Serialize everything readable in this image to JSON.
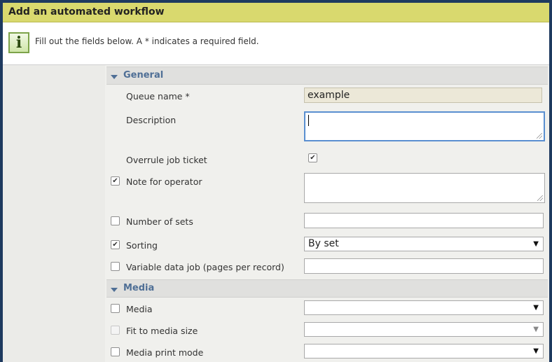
{
  "dialog": {
    "title": "Add an automated workflow"
  },
  "info": {
    "message": "Fill out the fields below. A * indicates a required field.",
    "icon": "info-icon"
  },
  "sections": {
    "general": {
      "label": "General",
      "queue_name": {
        "label": "Queue name *",
        "value": "example"
      },
      "description": {
        "label": "Description",
        "value": ""
      },
      "overrule_job_ticket": {
        "label": "Overrule job ticket",
        "checked": true
      },
      "note_for_operator": {
        "label": "Note for operator",
        "checked": true,
        "value": ""
      },
      "number_of_sets": {
        "label": "Number of sets",
        "checked": false,
        "value": ""
      },
      "sorting": {
        "label": "Sorting",
        "checked": true,
        "value": "By set"
      },
      "variable_data_job": {
        "label": "Variable data job (pages per record)",
        "checked": false,
        "value": ""
      }
    },
    "media": {
      "label": "Media",
      "media": {
        "label": "Media",
        "checked": false,
        "value": ""
      },
      "fit_to_media_size": {
        "label": "Fit to media size",
        "checked": false,
        "disabled": true,
        "value": ""
      },
      "media_print_mode": {
        "label": "Media print mode",
        "checked": false,
        "value": ""
      }
    }
  },
  "symbols": {
    "check": "✔",
    "dropdown": "▼"
  },
  "colors": {
    "titlebar": "#d9d96e",
    "section_header_text": "#4f6f96",
    "focus_border": "#5a8fd0",
    "readonly_bg": "#ece8d8"
  }
}
